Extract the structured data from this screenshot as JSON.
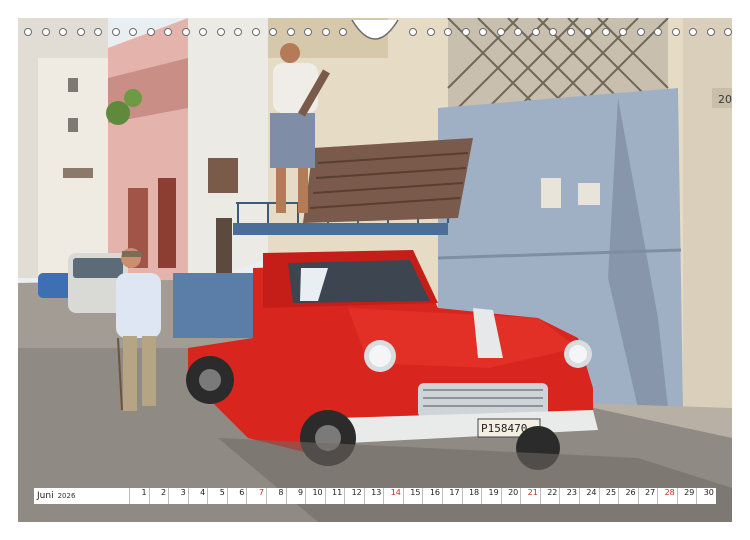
{
  "calendar": {
    "month": "Juni",
    "year": "2026",
    "days": [
      {
        "n": "1",
        "weekend": false
      },
      {
        "n": "2",
        "weekend": false
      },
      {
        "n": "3",
        "weekend": false
      },
      {
        "n": "4",
        "weekend": false
      },
      {
        "n": "5",
        "weekend": false
      },
      {
        "n": "6",
        "weekend": false
      },
      {
        "n": "7",
        "weekend": true
      },
      {
        "n": "8",
        "weekend": false
      },
      {
        "n": "9",
        "weekend": false
      },
      {
        "n": "10",
        "weekend": false
      },
      {
        "n": "11",
        "weekend": false
      },
      {
        "n": "12",
        "weekend": false
      },
      {
        "n": "13",
        "weekend": false
      },
      {
        "n": "14",
        "weekend": true
      },
      {
        "n": "15",
        "weekend": false
      },
      {
        "n": "16",
        "weekend": false
      },
      {
        "n": "17",
        "weekend": false
      },
      {
        "n": "18",
        "weekend": false
      },
      {
        "n": "19",
        "weekend": false
      },
      {
        "n": "20",
        "weekend": false
      },
      {
        "n": "21",
        "weekend": true
      },
      {
        "n": "22",
        "weekend": false
      },
      {
        "n": "23",
        "weekend": false
      },
      {
        "n": "24",
        "weekend": false
      },
      {
        "n": "25",
        "weekend": false
      },
      {
        "n": "26",
        "weekend": false
      },
      {
        "n": "27",
        "weekend": false
      },
      {
        "n": "28",
        "weekend": true
      },
      {
        "n": "29",
        "weekend": false
      },
      {
        "n": "30",
        "weekend": false
      }
    ]
  },
  "photo": {
    "plate_text": "P158470",
    "wall_number": "20",
    "colors": {
      "truck": "#d8261f",
      "door": "#9fb0c4",
      "sky": "#e9eef2",
      "street": "#8f8a84"
    }
  }
}
